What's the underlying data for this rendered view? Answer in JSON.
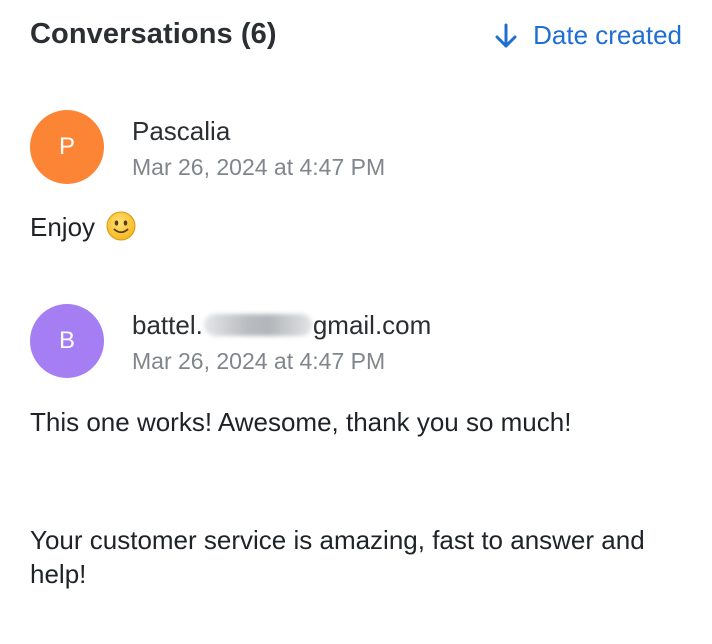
{
  "header": {
    "title": "Conversations (6)",
    "sort_label": "Date created",
    "sort_icon": "arrow-down-icon",
    "accent_color": "#1f6ed4"
  },
  "messages": [
    {
      "avatar_letter": "P",
      "avatar_color": "#fb8535",
      "sender": "Pascalia",
      "timestamp": "Mar 26, 2024 at 4:47 PM",
      "body": [
        "Enjoy"
      ],
      "emoji": "slightly-smiling-face-icon"
    },
    {
      "avatar_letter": "B",
      "avatar_color": "#a57ef4",
      "sender_prefix": "battel.",
      "sender_suffix": "gmail.com",
      "sender_redacted": true,
      "timestamp": "Mar 26, 2024 at 4:47 PM",
      "body": [
        "This one works! Awesome, thank you so much!",
        "Your customer service is amazing, fast to answer and help!"
      ]
    }
  ]
}
